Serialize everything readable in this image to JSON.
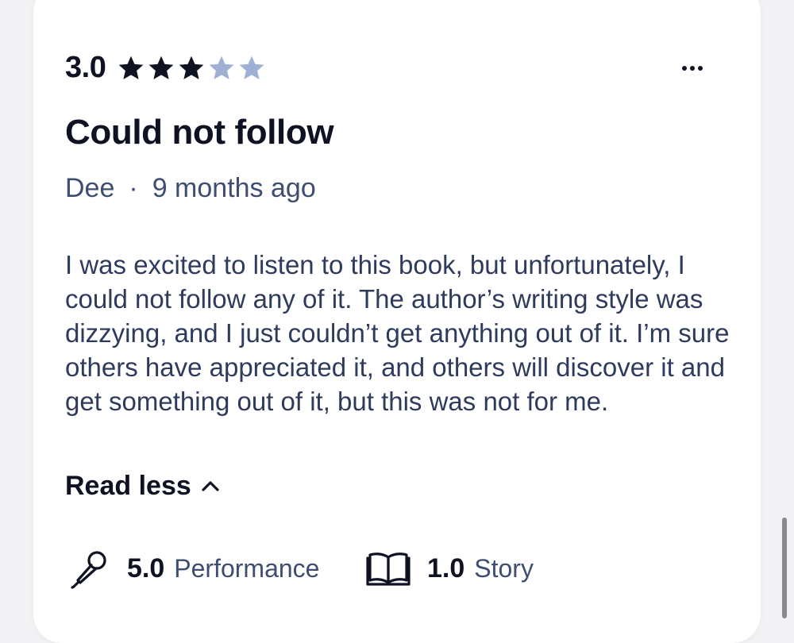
{
  "review": {
    "rating": "3.0",
    "stars_filled": 3,
    "stars_total": 5,
    "title": "Could not follow",
    "author": "Dee",
    "separator": "·",
    "time_ago": "9 months ago",
    "body": "I was excited to listen to this book, but unfortunately, I could not follow any of it. The author’s writing style was dizzying, and I just couldn’t get anything out of it. I’m sure others have appreciated it, and others will discover it and get something out of it, but this was not for me.",
    "read_less_label": "Read less",
    "sub_ratings": {
      "performance": {
        "value": "5.0",
        "label": "Performance",
        "icon": "microphone-icon"
      },
      "story": {
        "value": "1.0",
        "label": "Story",
        "icon": "book-icon"
      }
    }
  },
  "colors": {
    "star_filled": "#0f1222",
    "star_empty": "#9fb0d4",
    "text_primary": "#0f1222",
    "text_secondary": "#3f4d70"
  }
}
